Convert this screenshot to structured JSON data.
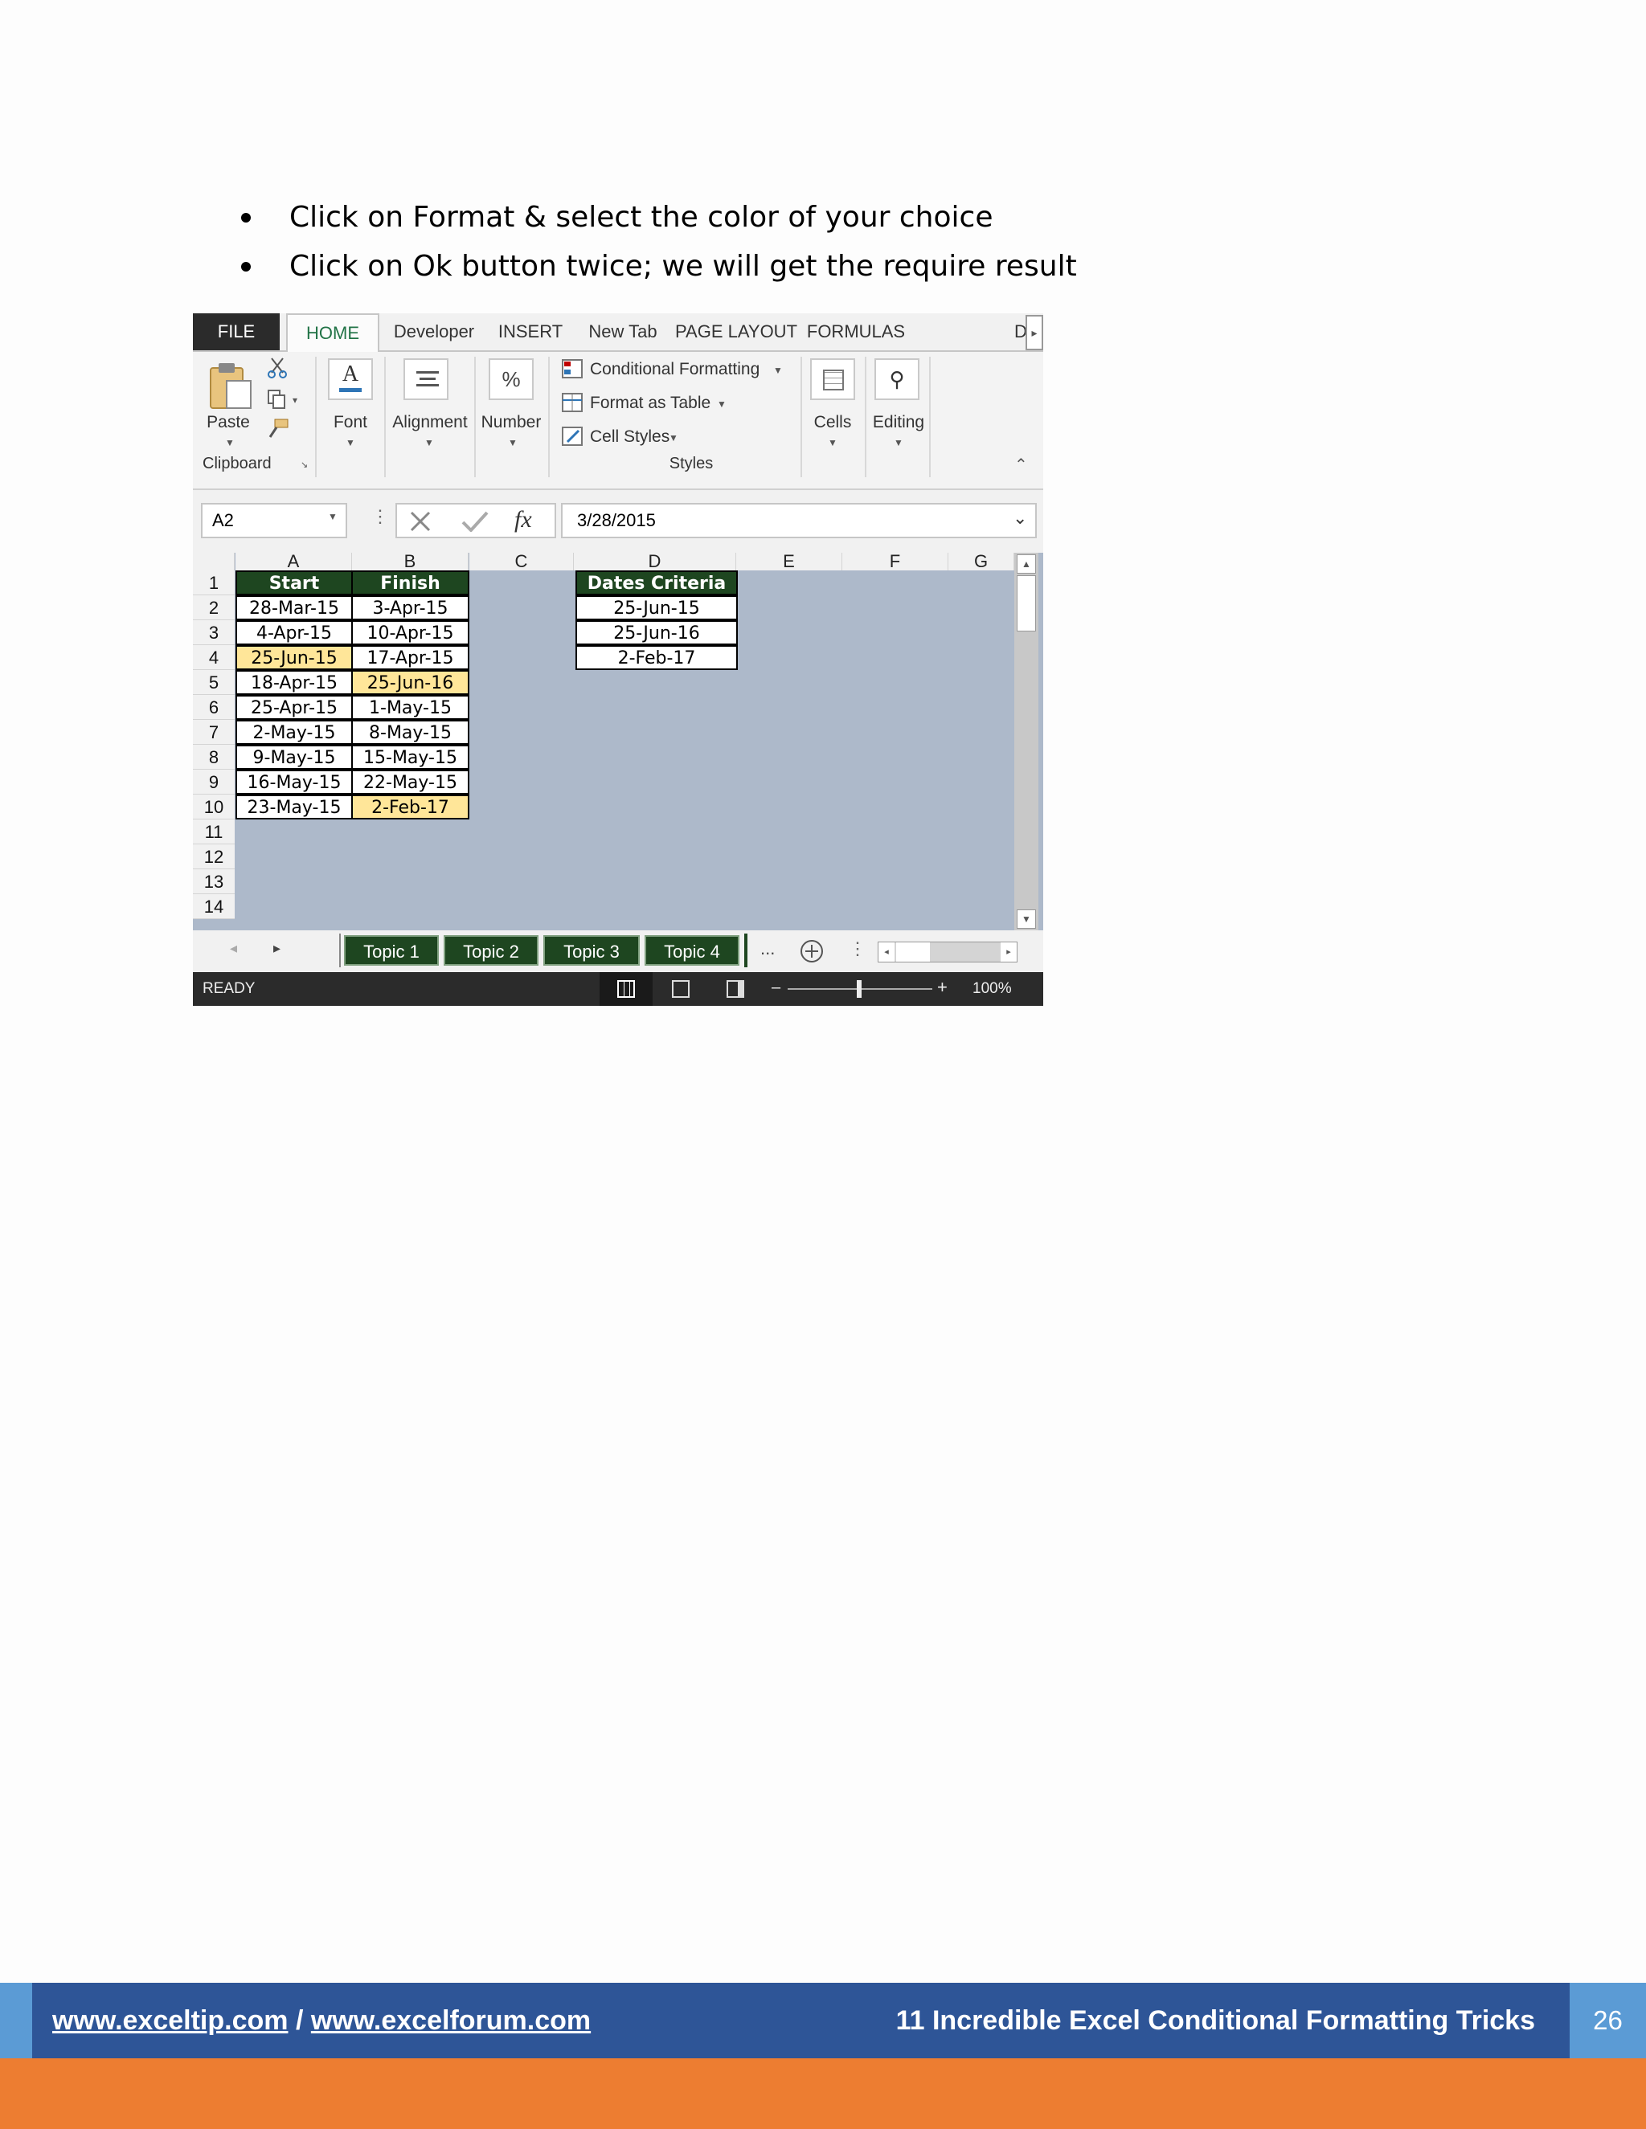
{
  "bullets": [
    "Click on Format & select the color of your choice",
    "Click on Ok button twice; we will get the require result"
  ],
  "excel": {
    "ribbon_tabs": [
      "FILE",
      "HOME",
      "Developer",
      "INSERT",
      "New Tab",
      "PAGE LAYOUT",
      "FORMULAS",
      "D"
    ],
    "active_tab": "HOME",
    "clipboard": {
      "paste": "Paste",
      "group": "Clipboard"
    },
    "font": "Font",
    "alignment": "Alignment",
    "number": "Number",
    "number_icon": "%",
    "styles": {
      "conditional_formatting": "Conditional Formatting",
      "format_as_table": "Format as Table",
      "cell_styles": "Cell Styles",
      "group": "Styles"
    },
    "cells": "Cells",
    "editing": "Editing",
    "name_box": "A2",
    "fx": "fx",
    "formula": "3/28/2015",
    "columns": [
      "A",
      "B",
      "C",
      "D",
      "E",
      "F",
      "G"
    ],
    "rows": [
      "1",
      "2",
      "3",
      "4",
      "5",
      "6",
      "7",
      "8",
      "9",
      "10",
      "11",
      "12",
      "13",
      "14"
    ],
    "table_headers": {
      "start": "Start",
      "finish": "Finish",
      "criteria": "Dates Criteria"
    },
    "start": [
      "28-Mar-15",
      "4-Apr-15",
      "25-Jun-15",
      "18-Apr-15",
      "25-Apr-15",
      "2-May-15",
      "9-May-15",
      "16-May-15",
      "23-May-15"
    ],
    "finish": [
      "3-Apr-15",
      "10-Apr-15",
      "17-Apr-15",
      "25-Jun-16",
      "1-May-15",
      "8-May-15",
      "15-May-15",
      "22-May-15",
      "2-Feb-17"
    ],
    "criteria": [
      "25-Jun-15",
      "25-Jun-16",
      "2-Feb-17"
    ],
    "highlight_color": "#ffe699",
    "header_color": "#1e4620",
    "sheet_tabs": [
      "Topic 1",
      "Topic 2",
      "Topic 3",
      "Topic 4"
    ],
    "ellipsis": "...",
    "status": "READY",
    "zoom": "100%"
  },
  "footer": {
    "link1": "www.exceltip.com",
    "sep": " / ",
    "link2": "www.excelforum.com",
    "title": "11 Incredible Excel Conditional Formatting Tricks",
    "page": "26"
  }
}
